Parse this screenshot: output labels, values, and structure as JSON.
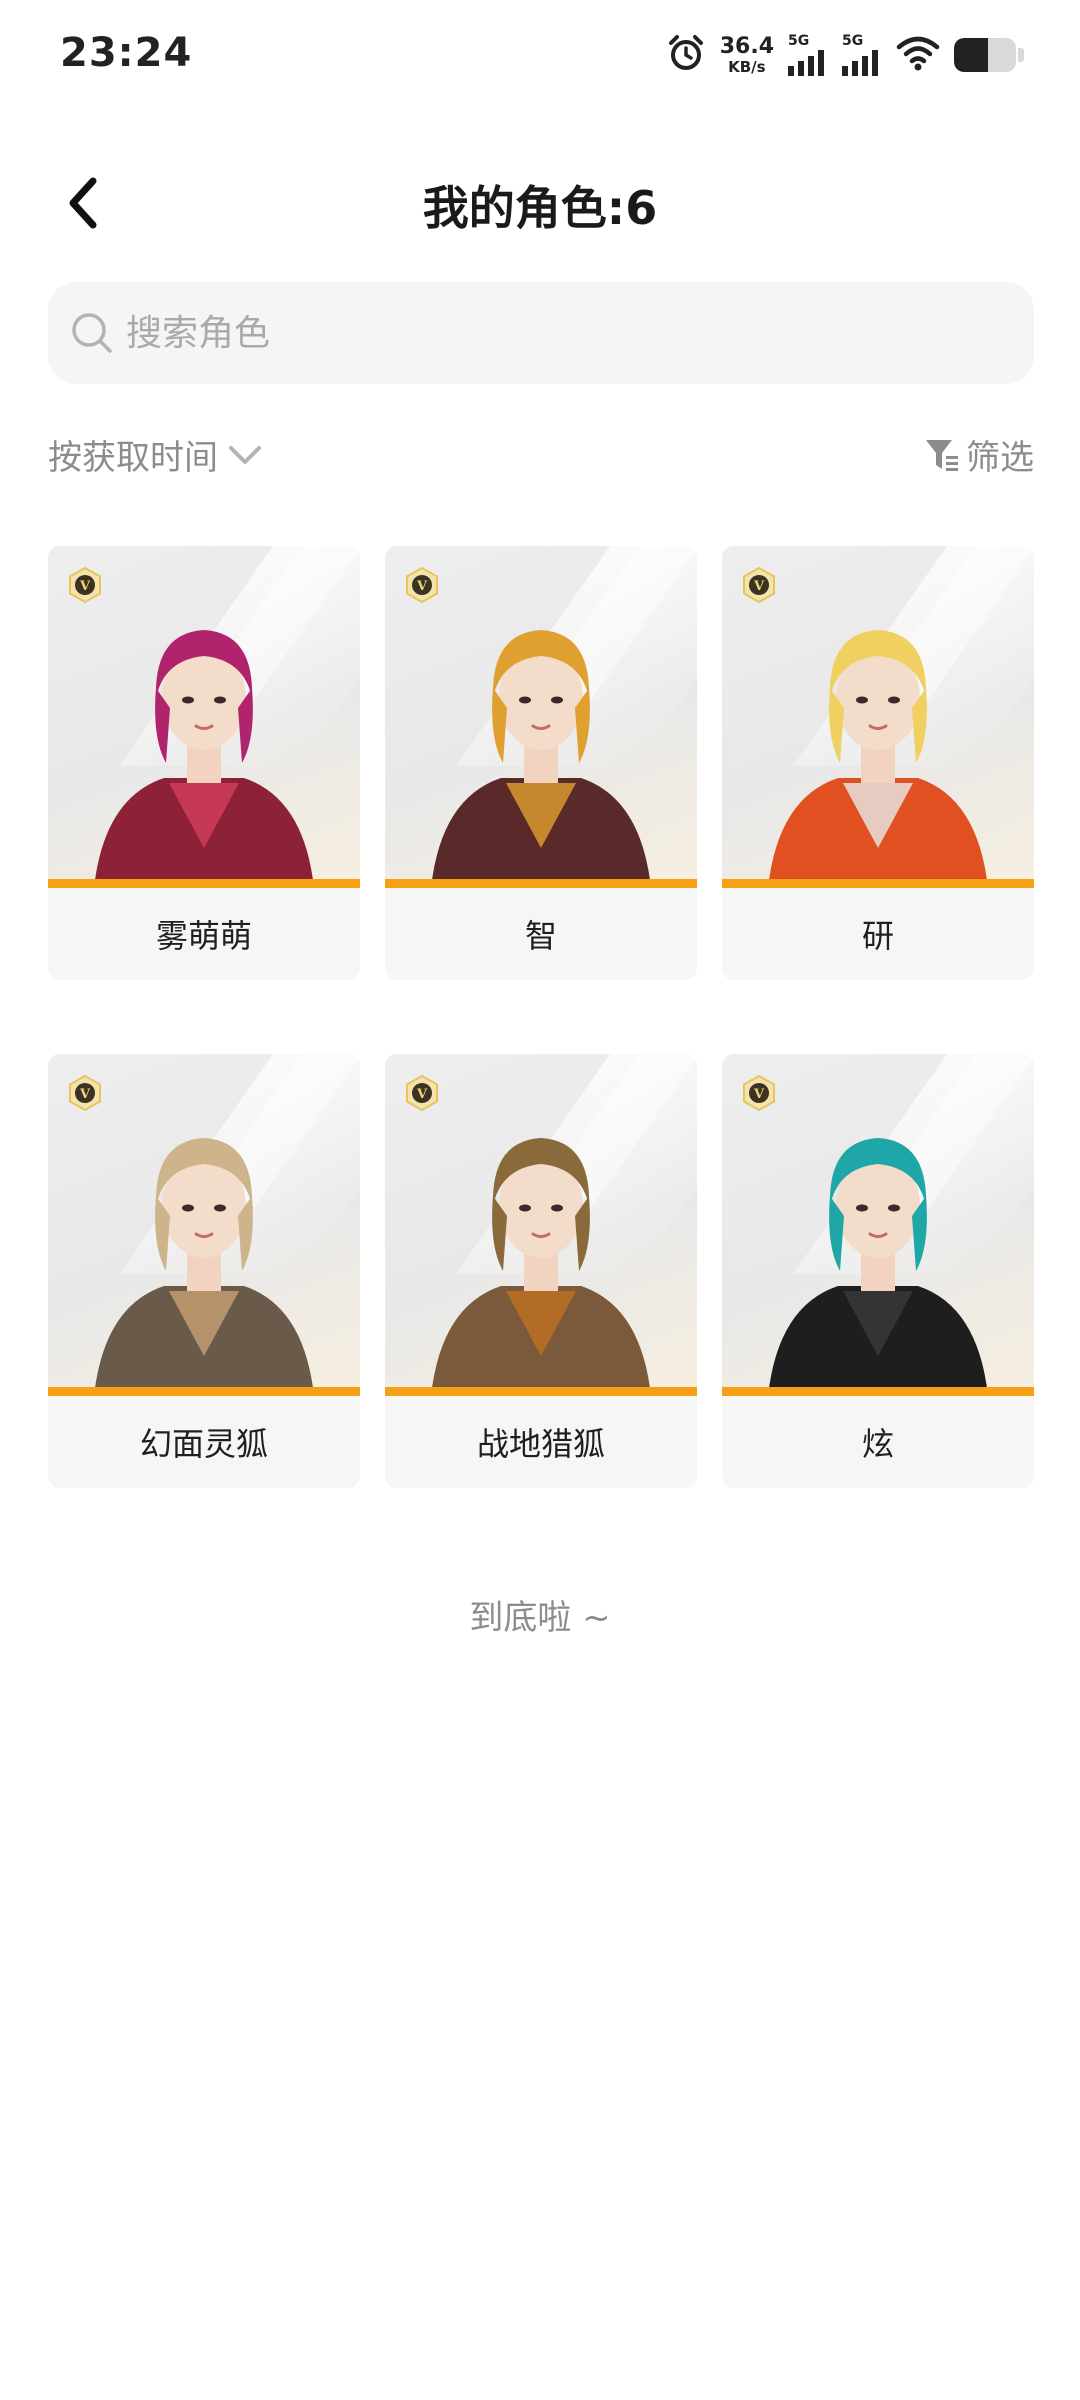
{
  "status_bar": {
    "time": "23:24",
    "speed_value": "36.4",
    "speed_unit": "KB/s",
    "sim1_label": "5G",
    "sim2_label": "5G",
    "battery_level": 0.55,
    "icons": [
      "alarm-icon",
      "signal-icon",
      "signal-icon",
      "wifi-icon",
      "battery-icon"
    ]
  },
  "header": {
    "title": "我的角色:6",
    "back_icon": "chevron-left-icon"
  },
  "search": {
    "placeholder": "搜索角色",
    "value": ""
  },
  "toolbar": {
    "sort_label": "按获取时间",
    "filter_label": "筛选"
  },
  "characters": [
    {
      "name": "雾萌萌",
      "badge": "V",
      "hair": "#b0246e",
      "outfit": "#8c2138",
      "accent": "#d4405c"
    },
    {
      "name": "智",
      "badge": "V",
      "hair": "#e0a030",
      "outfit": "#5a2a2a",
      "accent": "#e0a030"
    },
    {
      "name": "研",
      "badge": "V",
      "hair": "#f0d060",
      "outfit": "#e05020",
      "accent": "#e8e8e8"
    },
    {
      "name": "幻面灵狐",
      "badge": "V",
      "hair": "#cdb48a",
      "outfit": "#6a5a4a",
      "accent": "#c8a070"
    },
    {
      "name": "战地猎狐",
      "badge": "V",
      "hair": "#8a6a3a",
      "outfit": "#7a5a3a",
      "accent": "#c07020"
    },
    {
      "name": "炫",
      "badge": "V",
      "hair": "#1fa6a6",
      "outfit": "#1e1e1e",
      "accent": "#3a3a3a"
    }
  ],
  "footer": {
    "end_text": "到底啦 ~"
  },
  "colors": {
    "accent_bar": "#f5a015",
    "muted_text": "#8c8c8c",
    "search_bg": "#f5f5f5"
  }
}
